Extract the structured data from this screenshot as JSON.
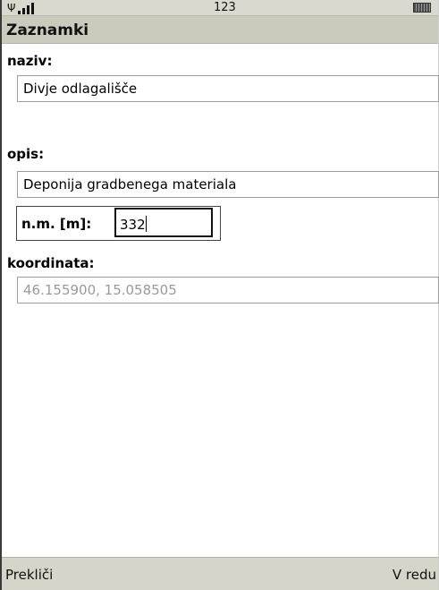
{
  "status_bar": {
    "signal_icon": "antenna-signal-icon",
    "center_text": "123",
    "battery_icon": "battery-icon"
  },
  "screen": {
    "title": "Zaznamki"
  },
  "form": {
    "naziv": {
      "label": "naziv:",
      "value": "Divje odlagališče"
    },
    "opis": {
      "label": "opis:",
      "value": "Deponija gradbenega materiala"
    },
    "nm": {
      "label": "n.m. [m]:",
      "value": "332"
    },
    "koordinata": {
      "label": "koordinata:",
      "value": "46.155900, 15.058505"
    }
  },
  "softkeys": {
    "left": "Prekliči",
    "right": "V redu"
  }
}
